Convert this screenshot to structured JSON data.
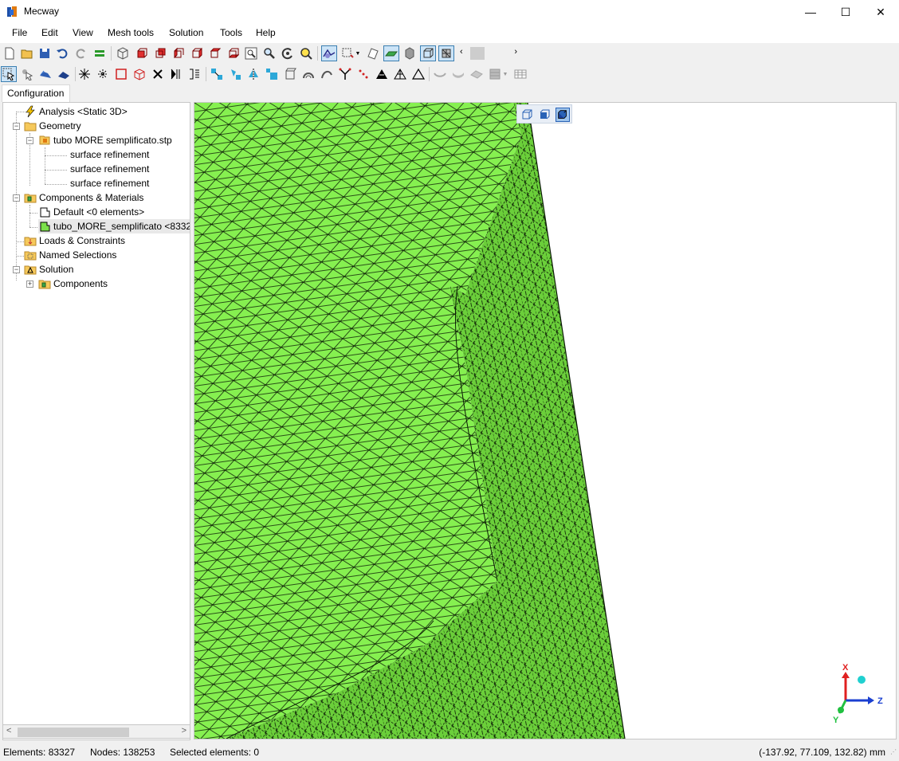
{
  "window": {
    "title": "Mecway",
    "minimize_glyph": "—",
    "maximize_glyph": "☐",
    "close_glyph": "✕"
  },
  "menu": [
    "File",
    "Edit",
    "View",
    "Mesh tools",
    "Solution",
    "Tools",
    "Help"
  ],
  "tabs": {
    "configuration": "Configuration"
  },
  "tree": {
    "analysis": "Analysis <Static 3D>",
    "geometry": "Geometry",
    "geometry_file": "tubo MORE semplificato.stp",
    "refinement_1": "surface refinement",
    "refinement_2": "surface refinement",
    "refinement_3": "surface refinement",
    "components_materials": "Components & Materials",
    "component_default": "Default <0 elements>",
    "component_tubo": "tubo_MORE_semplificato <8332",
    "loads_constraints": "Loads & Constraints",
    "named_selections": "Named Selections",
    "solution": "Solution",
    "solution_components": "Components",
    "expand_glyph": "+",
    "collapse_glyph": "−"
  },
  "triad": {
    "x": "X",
    "y": "Y",
    "z": "Z"
  },
  "status": {
    "elements": "Elements: 83327",
    "nodes": "Nodes: 138253",
    "selected": "Selected elements: 0",
    "coordinates": "(-137.92, 77.109, 132.82) mm"
  },
  "colors": {
    "mesh_light": "#86f050",
    "mesh_dark": "#6bcf3a",
    "mesh_lines": "#0a1a05",
    "accent_blue": "#2a63b6"
  }
}
